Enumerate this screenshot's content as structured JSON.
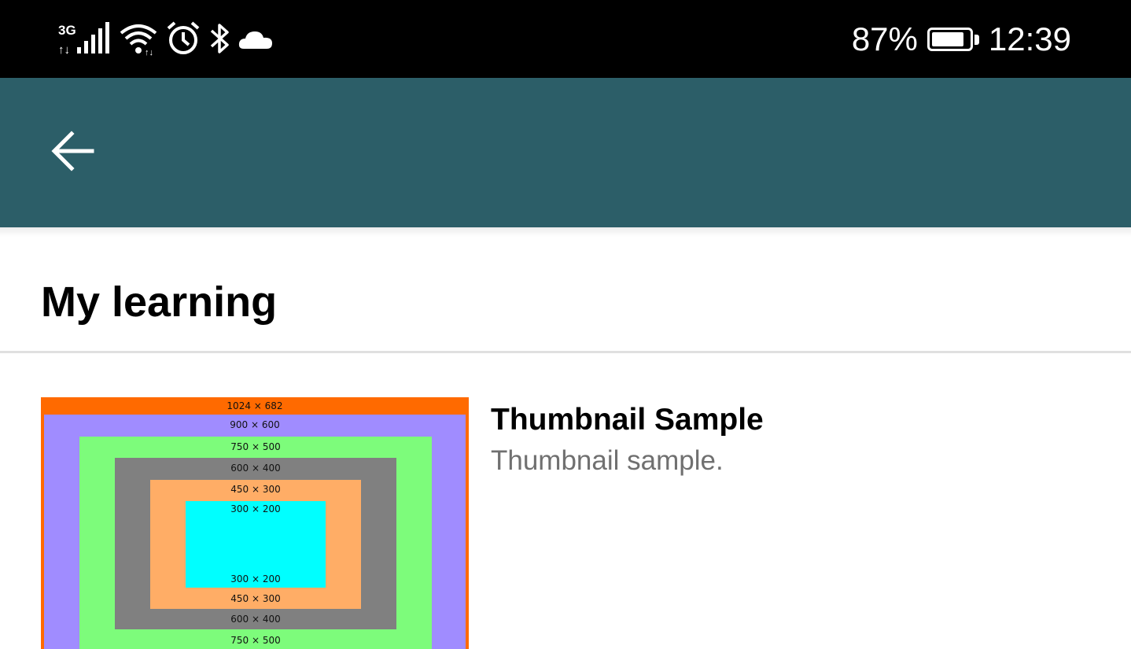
{
  "status_bar": {
    "network_type": "3G",
    "battery_percent": "87%",
    "battery_level": 0.87,
    "time": "12:39",
    "icons": [
      "signal-icon",
      "wifi-icon",
      "alarm-icon",
      "bluetooth-icon",
      "cloud-icon",
      "battery-icon"
    ]
  },
  "app_bar": {
    "back_icon": "arrow-left-icon",
    "color": "#2c5e68"
  },
  "section": {
    "title": "My learning"
  },
  "courses": [
    {
      "title": "Thumbnail Sample",
      "description": "Thumbnail sample.",
      "thumbnail": {
        "labels": [
          "1024 × 682",
          "900 × 600",
          "750 × 500",
          "600 × 400",
          "450 × 300",
          "300 × 200",
          "300 × 200",
          "450 × 300",
          "600 × 400",
          "750 × 500"
        ],
        "colors": [
          "#ff6a00",
          "#a08cff",
          "#7dfc7b",
          "#808080",
          "#ffad66",
          "#00ffff"
        ]
      }
    }
  ]
}
